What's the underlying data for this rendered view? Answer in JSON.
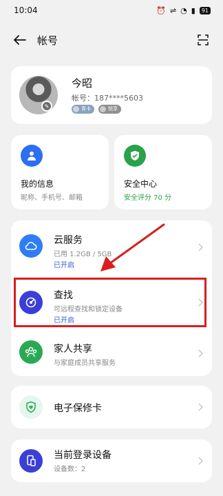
{
  "status_bar": {
    "time": "10:04",
    "battery": "91"
  },
  "header": {
    "title": "帐号"
  },
  "profile": {
    "name": "今昭",
    "account": "帐号：187****5603",
    "badges": [
      "青卡",
      "悦享"
    ]
  },
  "info": {
    "title": "我的信息",
    "subtitle": "昵称、手机号、邮箱"
  },
  "security": {
    "title": "安全中心",
    "subtitle": "安全评分 70 分"
  },
  "services": [
    {
      "title": "云服务",
      "subtitle": "已用 1.2GB / 5GB",
      "status": "已开启",
      "icon": "cloud-icon",
      "color": "#2f7cf6"
    },
    {
      "title": "查找",
      "subtitle": "可远程查找和锁定设备",
      "status": "已开启",
      "icon": "radar-icon",
      "color": "#3a3fd8"
    },
    {
      "title": "家人共享",
      "subtitle": "与家庭成员共享服务",
      "icon": "family-icon",
      "color": "#29a956"
    }
  ],
  "warranty": {
    "title": "电子保修卡",
    "icon": "shield-heart-icon",
    "color": "#2cae5e"
  },
  "devices": {
    "title": "当前登录设备",
    "subtitle": "设备数：2",
    "icon": "device-icon",
    "color": "#3a3fd8"
  },
  "colors": {
    "accent_blue": "#2d5fd6",
    "green": "#2aa14b",
    "highlight_red": "#d81e1e"
  }
}
